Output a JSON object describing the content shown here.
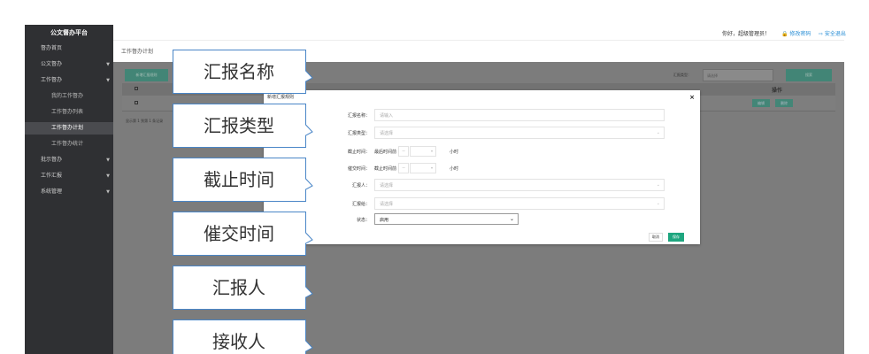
{
  "sidebar": {
    "brand": "公文督办平台",
    "items": [
      {
        "label": "督办首页",
        "arrow": ""
      },
      {
        "label": "公文督办",
        "arrow": "▼"
      },
      {
        "label": "工作督办",
        "arrow": "▼"
      },
      {
        "label": "我的工作督办",
        "arrow": ""
      },
      {
        "label": "工作督办列表",
        "arrow": ""
      },
      {
        "label": "工作督办计划",
        "arrow": ""
      },
      {
        "label": "工作督办统计",
        "arrow": ""
      },
      {
        "label": "批示督办",
        "arrow": "▼"
      },
      {
        "label": "工作汇报",
        "arrow": "▼"
      },
      {
        "label": "系统管理",
        "arrow": "▼"
      }
    ]
  },
  "topbar": {
    "greeting": "你好，超级管理员！",
    "change_password": "🔒 修改密码",
    "safe_exit": "⇨ 安全退出"
  },
  "breadcrumb": "工作督办计划",
  "content": {
    "add_button": "新增汇报规则",
    "type_label": "汇报类型：",
    "type_placeholder": "请选择",
    "search_button": "搜索",
    "operation_header": "操作",
    "edit_button": "编辑",
    "delete_button": "删除",
    "pager": "显示第 1 到第 1 条记录"
  },
  "modal": {
    "title": "新增汇报规则",
    "close": "×",
    "name_label": "汇报名称：",
    "name_placeholder": "请输入",
    "type_label": "汇报类型：",
    "type_placeholder": "请选择",
    "deadline_label": "截止时间：",
    "deadline_prefix": "最后时间前",
    "deadline_unit": "小时",
    "urge_label": "催交时间：",
    "urge_prefix": "截止时间前",
    "urge_unit": "小时",
    "reporter_label": "汇报人：",
    "reporter_placeholder": "请选择",
    "receiver_label": "汇报给：",
    "receiver_placeholder": "请选择",
    "status_label": "状态：",
    "status_value": "启用",
    "cancel_button": "取消",
    "save_button": "保存"
  },
  "callouts": [
    "汇报名称",
    "汇报类型",
    "截止时间",
    "催交时间",
    "汇报人",
    "接收人"
  ]
}
